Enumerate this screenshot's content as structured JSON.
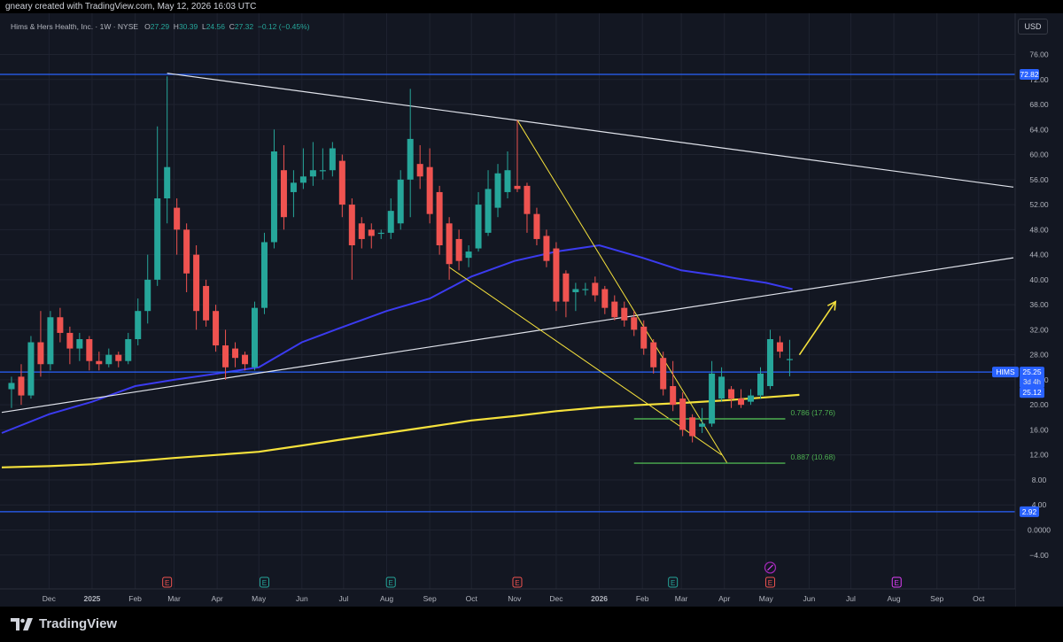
{
  "header": {
    "caption": "gneary created with TradingView.com, May 12, 2026 16:03 UTC",
    "currency": "USD"
  },
  "legend": {
    "name": "Hims & Hers Health, Inc. · 1W · NYSE",
    "o_label": "O",
    "o_value": "27.29",
    "h_label": "H",
    "h_value": "30.39",
    "l_label": "L",
    "l_value": "24.56",
    "c_label": "C",
    "c_value": "27.32",
    "change": "−0.12 (−0.45%)"
  },
  "footer": {
    "brand": "TradingView"
  },
  "colors": {
    "background": "#131722",
    "up": "#26a69a",
    "down": "#ef5350",
    "ma_fast": "#3b3bf0",
    "ma_slow": "#f5e13c",
    "hline": "#2962ff",
    "trendline": "#e0e3eb",
    "wedge": "#f5e13c",
    "fib": "#4caf50"
  },
  "chart_data": {
    "type": "candlestick",
    "symbol": "HIMS",
    "interval": "1W",
    "ylim": [
      -4,
      80
    ],
    "y_ticks": [
      76,
      72,
      68,
      64,
      60,
      56,
      52,
      48,
      44,
      40,
      36,
      32,
      28,
      24,
      20,
      16,
      12,
      8,
      4,
      0,
      -4
    ],
    "y_tick_labels": [
      "76.00",
      "72.00",
      "68.00",
      "64.00",
      "60.00",
      "56.00",
      "52.00",
      "48.00",
      "44.00",
      "40.00",
      "36.00",
      "32.00",
      "28.00",
      "24.00",
      "20.00",
      "16.00",
      "12.00",
      "8.00",
      "4.00",
      "0.0000",
      "−4.00"
    ],
    "x_labels": [
      {
        "date": "2024-12-01",
        "label": "Dec"
      },
      {
        "date": "2025-01-01",
        "label": "2025"
      },
      {
        "date": "2025-02-01",
        "label": "Feb"
      },
      {
        "date": "2025-03-01",
        "label": "Mar"
      },
      {
        "date": "2025-04-01",
        "label": "Apr"
      },
      {
        "date": "2025-05-01",
        "label": "May"
      },
      {
        "date": "2025-06-01",
        "label": "Jun"
      },
      {
        "date": "2025-07-01",
        "label": "Jul"
      },
      {
        "date": "2025-08-01",
        "label": "Aug"
      },
      {
        "date": "2025-09-01",
        "label": "Sep"
      },
      {
        "date": "2025-10-01",
        "label": "Oct"
      },
      {
        "date": "2025-11-01",
        "label": "Nov"
      },
      {
        "date": "2025-12-01",
        "label": "Dec"
      },
      {
        "date": "2026-01-01",
        "label": "2026"
      },
      {
        "date": "2026-02-01",
        "label": "Feb"
      },
      {
        "date": "2026-03-01",
        "label": "Mar"
      },
      {
        "date": "2026-04-01",
        "label": "Apr"
      },
      {
        "date": "2026-05-01",
        "label": "May"
      },
      {
        "date": "2026-06-01",
        "label": "Jun"
      },
      {
        "date": "2026-07-01",
        "label": "Jul"
      },
      {
        "date": "2026-08-01",
        "label": "Aug"
      },
      {
        "date": "2026-09-01",
        "label": "Sep"
      },
      {
        "date": "2026-10-01",
        "label": "Oct"
      }
    ],
    "candles": [
      {
        "date": "2024-11-04",
        "o": 22.5,
        "h": 24.5,
        "l": 19.5,
        "c": 23.5
      },
      {
        "date": "2024-11-11",
        "o": 24.5,
        "h": 26.5,
        "l": 20.0,
        "c": 21.5
      },
      {
        "date": "2024-11-18",
        "o": 21.5,
        "h": 31.0,
        "l": 21.0,
        "c": 30.0
      },
      {
        "date": "2024-11-25",
        "o": 30.0,
        "h": 35.0,
        "l": 24.5,
        "c": 26.5
      },
      {
        "date": "2024-12-02",
        "o": 26.5,
        "h": 35.0,
        "l": 25.5,
        "c": 34.0
      },
      {
        "date": "2024-12-09",
        "o": 34.0,
        "h": 35.5,
        "l": 30.0,
        "c": 31.5
      },
      {
        "date": "2024-12-16",
        "o": 31.5,
        "h": 32.5,
        "l": 26.5,
        "c": 29.0
      },
      {
        "date": "2024-12-23",
        "o": 29.0,
        "h": 31.5,
        "l": 27.0,
        "c": 30.5
      },
      {
        "date": "2024-12-30",
        "o": 30.5,
        "h": 31.0,
        "l": 25.5,
        "c": 27.0
      },
      {
        "date": "2025-01-06",
        "o": 27.0,
        "h": 28.5,
        "l": 25.5,
        "c": 26.5
      },
      {
        "date": "2025-01-13",
        "o": 26.5,
        "h": 29.0,
        "l": 26.0,
        "c": 28.0
      },
      {
        "date": "2025-01-20",
        "o": 28.0,
        "h": 28.5,
        "l": 26.0,
        "c": 27.0
      },
      {
        "date": "2025-01-27",
        "o": 27.0,
        "h": 31.5,
        "l": 26.5,
        "c": 30.5
      },
      {
        "date": "2025-02-03",
        "o": 30.5,
        "h": 37.0,
        "l": 29.5,
        "c": 35.0
      },
      {
        "date": "2025-02-10",
        "o": 35.0,
        "h": 44.0,
        "l": 33.0,
        "c": 40.0
      },
      {
        "date": "2025-02-17",
        "o": 40.0,
        "h": 64.5,
        "l": 39.0,
        "c": 53.0
      },
      {
        "date": "2025-02-24",
        "o": 53.0,
        "h": 72.5,
        "l": 49.0,
        "c": 58.0
      },
      {
        "date": "2025-03-03",
        "o": 51.5,
        "h": 53.0,
        "l": 44.0,
        "c": 48.0
      },
      {
        "date": "2025-03-10",
        "o": 48.0,
        "h": 49.0,
        "l": 38.0,
        "c": 41.0
      },
      {
        "date": "2025-03-17",
        "o": 44.0,
        "h": 45.5,
        "l": 32.0,
        "c": 35.0
      },
      {
        "date": "2025-03-24",
        "o": 39.0,
        "h": 40.0,
        "l": 32.5,
        "c": 33.5
      },
      {
        "date": "2025-03-31",
        "o": 35.0,
        "h": 36.0,
        "l": 28.5,
        "c": 29.5
      },
      {
        "date": "2025-04-07",
        "o": 29.5,
        "h": 32.0,
        "l": 24.0,
        "c": 26.0
      },
      {
        "date": "2025-04-14",
        "o": 29.0,
        "h": 30.0,
        "l": 26.0,
        "c": 27.5
      },
      {
        "date": "2025-04-21",
        "o": 28.0,
        "h": 28.5,
        "l": 25.5,
        "c": 26.5
      },
      {
        "date": "2025-04-28",
        "o": 26.0,
        "h": 36.5,
        "l": 25.5,
        "c": 35.5
      },
      {
        "date": "2025-05-05",
        "o": 35.5,
        "h": 47.5,
        "l": 34.5,
        "c": 46.0
      },
      {
        "date": "2025-05-12",
        "o": 46.0,
        "h": 64.0,
        "l": 45.0,
        "c": 60.5
      },
      {
        "date": "2025-05-19",
        "o": 57.5,
        "h": 61.5,
        "l": 48.0,
        "c": 50.0
      },
      {
        "date": "2025-05-26",
        "o": 54.0,
        "h": 57.5,
        "l": 50.0,
        "c": 55.5
      },
      {
        "date": "2025-06-02",
        "o": 55.5,
        "h": 61.0,
        "l": 54.5,
        "c": 56.5
      },
      {
        "date": "2025-06-09",
        "o": 56.5,
        "h": 62.0,
        "l": 55.0,
        "c": 57.5
      },
      {
        "date": "2025-06-16",
        "o": 57.5,
        "h": 61.0,
        "l": 56.0,
        "c": 57.5
      },
      {
        "date": "2025-06-23",
        "o": 57.5,
        "h": 62.0,
        "l": 56.5,
        "c": 61.0
      },
      {
        "date": "2025-06-30",
        "o": 59.0,
        "h": 60.0,
        "l": 50.0,
        "c": 52.0
      },
      {
        "date": "2025-07-07",
        "o": 52.0,
        "h": 53.0,
        "l": 40.0,
        "c": 45.5
      },
      {
        "date": "2025-07-14",
        "o": 49.0,
        "h": 50.0,
        "l": 45.0,
        "c": 46.5
      },
      {
        "date": "2025-07-21",
        "o": 48.0,
        "h": 49.0,
        "l": 45.0,
        "c": 47.0
      },
      {
        "date": "2025-07-28",
        "o": 47.5,
        "h": 48.0,
        "l": 46.5,
        "c": 47.5
      },
      {
        "date": "2025-08-04",
        "o": 47.5,
        "h": 53.0,
        "l": 46.5,
        "c": 51.0
      },
      {
        "date": "2025-08-11",
        "o": 49.0,
        "h": 57.5,
        "l": 48.0,
        "c": 56.0
      },
      {
        "date": "2025-08-18",
        "o": 56.0,
        "h": 70.5,
        "l": 50.0,
        "c": 62.5
      },
      {
        "date": "2025-08-25",
        "o": 58.5,
        "h": 61.5,
        "l": 54.5,
        "c": 56.5
      },
      {
        "date": "2025-09-01",
        "o": 58.0,
        "h": 61.0,
        "l": 49.0,
        "c": 50.5
      },
      {
        "date": "2025-09-08",
        "o": 54.0,
        "h": 55.0,
        "l": 44.0,
        "c": 45.5
      },
      {
        "date": "2025-09-15",
        "o": 49.0,
        "h": 50.0,
        "l": 40.0,
        "c": 42.5
      },
      {
        "date": "2025-09-22",
        "o": 46.5,
        "h": 48.0,
        "l": 41.5,
        "c": 43.0
      },
      {
        "date": "2025-09-29",
        "o": 43.5,
        "h": 45.5,
        "l": 42.0,
        "c": 44.5
      },
      {
        "date": "2025-10-06",
        "o": 45.0,
        "h": 54.0,
        "l": 44.5,
        "c": 52.0
      },
      {
        "date": "2025-10-13",
        "o": 47.5,
        "h": 57.5,
        "l": 47.0,
        "c": 54.5
      },
      {
        "date": "2025-10-20",
        "o": 51.5,
        "h": 58.5,
        "l": 50.0,
        "c": 57.0
      },
      {
        "date": "2025-10-27",
        "o": 54.0,
        "h": 60.5,
        "l": 53.0,
        "c": 57.5
      },
      {
        "date": "2025-11-03",
        "o": 55.0,
        "h": 65.5,
        "l": 54.0,
        "c": 54.5
      },
      {
        "date": "2025-11-10",
        "o": 55.0,
        "h": 55.5,
        "l": 47.5,
        "c": 50.5
      },
      {
        "date": "2025-11-17",
        "o": 50.5,
        "h": 51.5,
        "l": 45.5,
        "c": 46.5
      },
      {
        "date": "2025-11-24",
        "o": 47.0,
        "h": 48.0,
        "l": 42.0,
        "c": 43.0
      },
      {
        "date": "2025-12-01",
        "o": 45.0,
        "h": 46.0,
        "l": 35.0,
        "c": 36.5
      },
      {
        "date": "2025-12-08",
        "o": 41.0,
        "h": 41.5,
        "l": 34.0,
        "c": 36.5
      },
      {
        "date": "2025-12-15",
        "o": 38.0,
        "h": 39.5,
        "l": 35.0,
        "c": 38.5
      },
      {
        "date": "2025-12-22",
        "o": 38.5,
        "h": 39.5,
        "l": 37.5,
        "c": 38.5
      },
      {
        "date": "2025-12-29",
        "o": 39.5,
        "h": 40.5,
        "l": 36.5,
        "c": 37.5
      },
      {
        "date": "2026-01-05",
        "o": 38.5,
        "h": 39.0,
        "l": 34.5,
        "c": 35.5
      },
      {
        "date": "2026-01-12",
        "o": 36.5,
        "h": 37.5,
        "l": 33.5,
        "c": 34.0
      },
      {
        "date": "2026-01-19",
        "o": 35.5,
        "h": 36.5,
        "l": 32.5,
        "c": 33.5
      },
      {
        "date": "2026-01-26",
        "o": 34.0,
        "h": 35.0,
        "l": 31.0,
        "c": 32.0
      },
      {
        "date": "2026-02-02",
        "o": 32.5,
        "h": 33.5,
        "l": 28.0,
        "c": 29.0
      },
      {
        "date": "2026-02-09",
        "o": 30.0,
        "h": 30.5,
        "l": 25.0,
        "c": 26.0
      },
      {
        "date": "2026-02-16",
        "o": 27.5,
        "h": 28.5,
        "l": 21.5,
        "c": 22.5
      },
      {
        "date": "2026-02-23",
        "o": 23.0,
        "h": 27.0,
        "l": 19.0,
        "c": 20.0
      },
      {
        "date": "2026-03-02",
        "o": 21.0,
        "h": 22.0,
        "l": 15.0,
        "c": 16.0
      },
      {
        "date": "2026-03-09",
        "o": 18.0,
        "h": 18.5,
        "l": 14.0,
        "c": 15.0
      },
      {
        "date": "2026-03-16",
        "o": 16.5,
        "h": 19.5,
        "l": 15.5,
        "c": 17.0
      },
      {
        "date": "2026-03-23",
        "o": 17.0,
        "h": 27.0,
        "l": 16.5,
        "c": 25.0
      },
      {
        "date": "2026-03-30",
        "o": 21.0,
        "h": 26.0,
        "l": 20.5,
        "c": 24.5
      },
      {
        "date": "2026-04-06",
        "o": 22.5,
        "h": 23.0,
        "l": 19.5,
        "c": 21.0
      },
      {
        "date": "2026-04-13",
        "o": 21.0,
        "h": 22.5,
        "l": 19.5,
        "c": 20.0
      },
      {
        "date": "2026-04-20",
        "o": 20.5,
        "h": 22.5,
        "l": 20.0,
        "c": 21.5
      },
      {
        "date": "2026-04-27",
        "o": 21.5,
        "h": 26.0,
        "l": 21.0,
        "c": 25.0
      },
      {
        "date": "2026-05-04",
        "o": 23.0,
        "h": 32.0,
        "l": 22.5,
        "c": 30.5
      },
      {
        "date": "2026-05-11",
        "o": 30.0,
        "h": 31.0,
        "l": 27.5,
        "c": 28.5
      },
      {
        "date": "2026-05-18",
        "o": 27.29,
        "h": 30.39,
        "l": 24.56,
        "c": 27.32
      }
    ],
    "series": [
      {
        "type": "line",
        "role": "ma_fast",
        "points": [
          [
            "2024-10-28",
            15.5
          ],
          [
            "2024-12-01",
            18.5
          ],
          [
            "2025-01-01",
            20.5
          ],
          [
            "2025-02-01",
            23.0
          ],
          [
            "2025-03-01",
            24.0
          ],
          [
            "2025-04-01",
            25.0
          ],
          [
            "2025-05-01",
            26.0
          ],
          [
            "2025-06-01",
            30.0
          ],
          [
            "2025-07-01",
            32.5
          ],
          [
            "2025-08-01",
            35.0
          ],
          [
            "2025-09-01",
            37.0
          ],
          [
            "2025-10-01",
            40.5
          ],
          [
            "2025-11-01",
            43.0
          ],
          [
            "2025-12-01",
            44.5
          ],
          [
            "2026-01-01",
            45.5
          ],
          [
            "2026-02-01",
            43.5
          ],
          [
            "2026-03-01",
            41.5
          ],
          [
            "2026-04-01",
            40.5
          ],
          [
            "2026-05-01",
            39.5
          ],
          [
            "2026-05-20",
            38.5
          ]
        ]
      },
      {
        "type": "line",
        "role": "ma_slow",
        "points": [
          [
            "2024-10-28",
            10.0
          ],
          [
            "2024-12-01",
            10.2
          ],
          [
            "2025-01-01",
            10.5
          ],
          [
            "2025-02-01",
            11.0
          ],
          [
            "2025-03-01",
            11.5
          ],
          [
            "2025-04-01",
            12.0
          ],
          [
            "2025-05-01",
            12.5
          ],
          [
            "2025-06-01",
            13.5
          ],
          [
            "2025-07-01",
            14.5
          ],
          [
            "2025-08-01",
            15.5
          ],
          [
            "2025-09-01",
            16.5
          ],
          [
            "2025-10-01",
            17.5
          ],
          [
            "2025-11-01",
            18.2
          ],
          [
            "2025-12-01",
            19.0
          ],
          [
            "2026-01-01",
            19.6
          ],
          [
            "2026-02-01",
            20.0
          ],
          [
            "2026-03-01",
            20.3
          ],
          [
            "2026-04-01",
            20.7
          ],
          [
            "2026-05-01",
            21.2
          ],
          [
            "2026-05-25",
            21.6
          ]
        ]
      }
    ],
    "horizontal_lines": [
      {
        "price": 72.82,
        "label": "72.82",
        "color": "#2962ff"
      },
      {
        "price": 25.25,
        "label": "HIMS",
        "color": "#2962ff"
      },
      {
        "price": 2.92,
        "label": "2.92",
        "color": "#2962ff"
      }
    ],
    "price_badges": [
      {
        "label": "HIMS",
        "value": "25.25",
        "sub": "3d 4h",
        "price": 25.25
      },
      {
        "label": "",
        "value": "25.12",
        "sub": "",
        "price": 22.4
      }
    ],
    "trendlines": [
      {
        "from": [
          "2024-10-28",
          18.8
        ],
        "to": [
          "2026-10-26",
          43.5
        ],
        "color": "#e0e3eb",
        "width": 1.2
      },
      {
        "from": [
          "2025-02-24",
          73.0
        ],
        "to": [
          "2026-10-26",
          54.8
        ],
        "color": "#e0e3eb",
        "width": 1.2
      },
      {
        "from": [
          "2025-11-03",
          65.5
        ],
        "to": [
          "2026-04-03",
          10.7
        ],
        "color": "#f5e13c",
        "width": 1.0
      },
      {
        "from": [
          "2025-09-15",
          42.0
        ],
        "to": [
          "2026-03-30",
          12.0
        ],
        "color": "#f5e13c",
        "width": 1.0
      }
    ],
    "arrows": [
      {
        "from": [
          "2026-05-25",
          28.0
        ],
        "to": [
          "2026-06-20",
          36.5
        ],
        "color": "#f5e13c"
      }
    ],
    "fib_levels": [
      {
        "ratio": 0.786,
        "label": "0.786 (17.76)",
        "price": 17.76,
        "from": "2026-01-26",
        "to": "2026-05-11",
        "color": "#4caf50"
      },
      {
        "ratio": 0.887,
        "label": "0.887 (10.68)",
        "price": 10.68,
        "from": "2026-01-26",
        "to": "2026-05-11",
        "color": "#4caf50"
      }
    ],
    "events": [
      {
        "date": "2025-02-24",
        "type": "earnings",
        "label": "E",
        "color": "#ef5350"
      },
      {
        "date": "2025-05-05",
        "type": "earnings",
        "label": "E",
        "color": "#26a69a"
      },
      {
        "date": "2025-08-04",
        "type": "earnings",
        "label": "E",
        "color": "#26a69a"
      },
      {
        "date": "2025-11-03",
        "type": "earnings",
        "label": "E",
        "color": "#ef5350"
      },
      {
        "date": "2026-02-23",
        "type": "earnings",
        "label": "E",
        "color": "#26a69a"
      },
      {
        "date": "2026-05-04",
        "type": "earnings",
        "label": "E",
        "color": "#ef5350"
      },
      {
        "date": "2026-08-03",
        "type": "earnings",
        "label": "E",
        "color": "#e040fb"
      }
    ]
  }
}
